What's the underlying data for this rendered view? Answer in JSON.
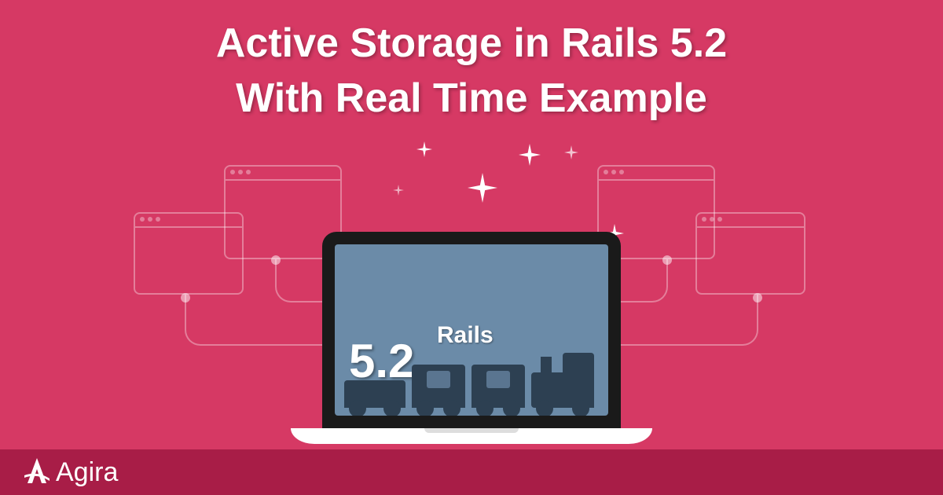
{
  "title_line1": "Active Storage in Rails 5.2",
  "title_line2": "With Real Time Example",
  "screen": {
    "version": "5.2",
    "framework": "Rails"
  },
  "brand": "Agira",
  "colors": {
    "background": "#d63964",
    "footer": "#a81d47",
    "screen": "#6b8ba8",
    "train": "#2d4052"
  }
}
